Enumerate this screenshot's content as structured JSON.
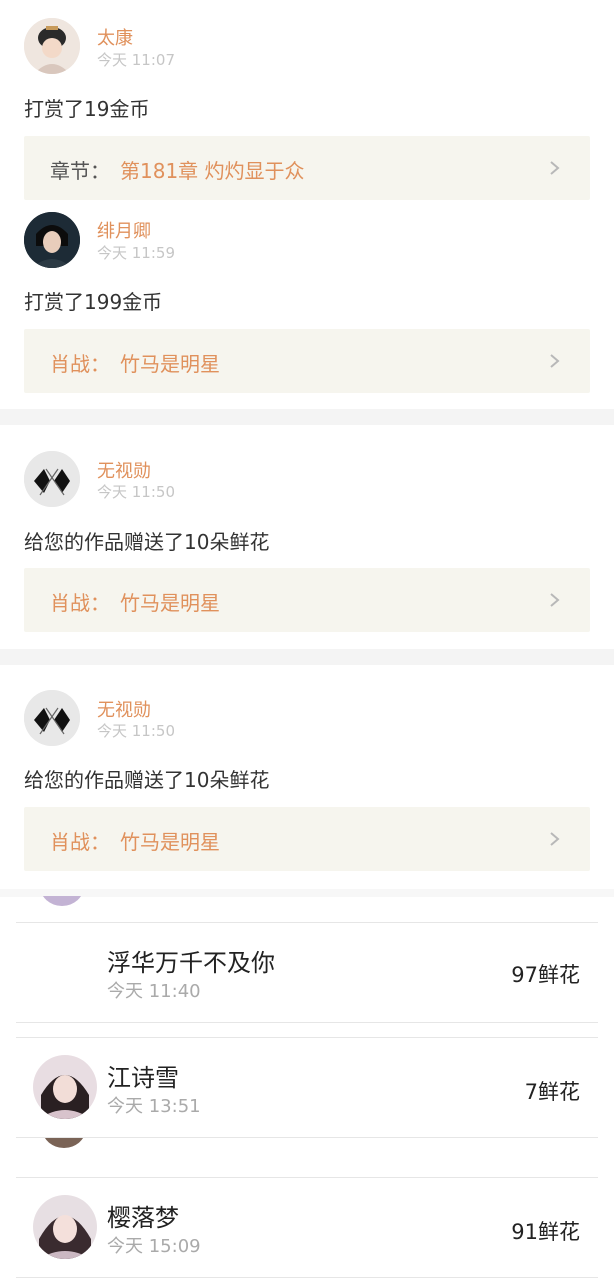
{
  "feed": [
    {
      "name": "太康",
      "time": "今天 11:07",
      "action": "打赏了19金币",
      "link_prefix": "章节：",
      "link_title": "第181章 灼灼显于众"
    },
    {
      "name": "绯月卿",
      "time": "今天 11:59",
      "action": "打赏了199金币",
      "link_prefix": "肖战：",
      "link_title": "竹马是明星"
    },
    {
      "name": "无视勋",
      "time": "今天 11:50",
      "action": "给您的作品赠送了10朵鲜花",
      "link_prefix": "肖战：",
      "link_title": "竹马是明星"
    },
    {
      "name": "无视勋",
      "time": "今天 11:50",
      "action": "给您的作品赠送了10朵鲜花",
      "link_prefix": "肖战：",
      "link_title": "竹马是明星"
    }
  ],
  "flower_list": [
    {
      "name": "浮华万千不及你",
      "time": "今天 11:40",
      "count": "97鲜花"
    },
    {
      "name": "江诗雪",
      "time": "今天 13:51",
      "count": "7鲜花"
    },
    {
      "name": "樱落梦",
      "time": "今天 15:09",
      "count": "91鲜花"
    }
  ],
  "colors": {
    "accent": "#e0915c",
    "link_bg": "#f6f5ee",
    "separator": "#f4f4f4",
    "muted": "#c6c6c6"
  }
}
